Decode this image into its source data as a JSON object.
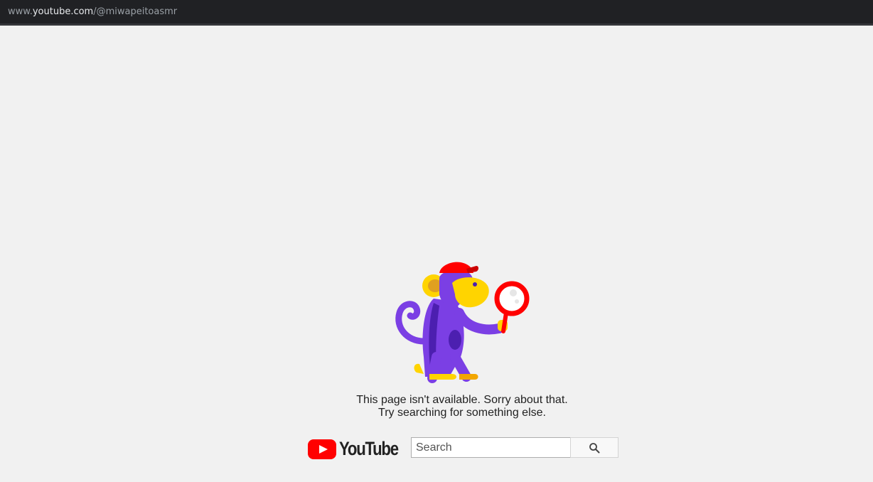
{
  "address_bar": {
    "url_prefix": "www.",
    "url_domain": "youtube.com",
    "url_path": "/@miwapeitoasmr"
  },
  "error": {
    "line1": "This page isn't available. Sorry about that.",
    "line2": "Try searching for something else."
  },
  "logo": {
    "wordmark": "YouTube",
    "brand_color": "#ff0000"
  },
  "search": {
    "placeholder": "Search",
    "value": "",
    "button_icon": "search-icon"
  },
  "illustration": {
    "name": "monkey-with-magnifier",
    "colors": {
      "body": "#7b3fe4",
      "body_dark": "#4c1fb0",
      "face": "#ffd400",
      "cap": "#ff0000",
      "feet": "#ffc107"
    }
  }
}
